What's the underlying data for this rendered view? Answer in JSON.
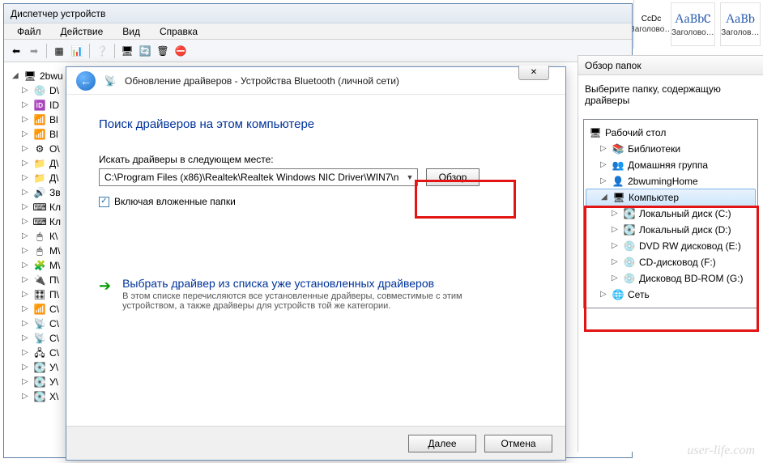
{
  "device_manager": {
    "title": "Диспетчер устройств",
    "menu": {
      "file": "Файл",
      "action": "Действие",
      "view": "Вид",
      "help": "Справка"
    },
    "tree_root": "2bwu",
    "nodes": [
      "D\\",
      "ID",
      "Bl",
      "Bl",
      "O\\",
      "Д\\",
      "Д\\",
      "Зв",
      "Кл",
      "Кл",
      "К\\",
      "М\\",
      "М\\",
      "П\\",
      "П\\",
      "С\\",
      "С\\",
      "С\\",
      "С\\",
      "У\\",
      "У\\",
      "Х\\"
    ]
  },
  "dialog": {
    "header": "Обновление драйверов - Устройства Bluetooth (личной сети)",
    "heading": "Поиск драйверов на этом компьютере",
    "location_label": "Искать драйверы в следующем месте:",
    "path": "C:\\Program Files (x86)\\Realtek\\Realtek Windows NIC Driver\\WIN7\\n",
    "browse": "Обзор",
    "include_sub": "Включая вложенные папки",
    "pick_title": "Выбрать драйвер из списка уже установленных драйверов",
    "pick_desc": "В этом списке перечисляются все установленные драйверы, совместимые с этим устройством, а также драйверы для устройств той же категории.",
    "next": "Далее",
    "cancel": "Отмена",
    "close_x": "✕"
  },
  "folder_browse": {
    "title": "Обзор папок",
    "hint": "Выберите папку, содержащую драйверы",
    "items": {
      "desktop": "Рабочий стол",
      "libraries": "Библиотеки",
      "homegroup": "Домашняя группа",
      "user": "2bwumingHome",
      "computer": "Компьютер",
      "disk_c": "Локальный диск (C:)",
      "disk_d": "Локальный диск (D:)",
      "dvd_rw": "DVD RW дисковод (E:)",
      "cd": "CD-дисковод (F:)",
      "bd": "Дисковод BD-ROM (G:)",
      "network": "Сеть"
    }
  },
  "styles": {
    "left_label": "CcDc",
    "left_sub": "Заголово…",
    "cell1_big": "АаBbC",
    "cell1_lbl": "Заголово…",
    "cell2_big": "АаBb",
    "cell2_lbl": "Заголов…"
  },
  "watermark": "user-life.com"
}
